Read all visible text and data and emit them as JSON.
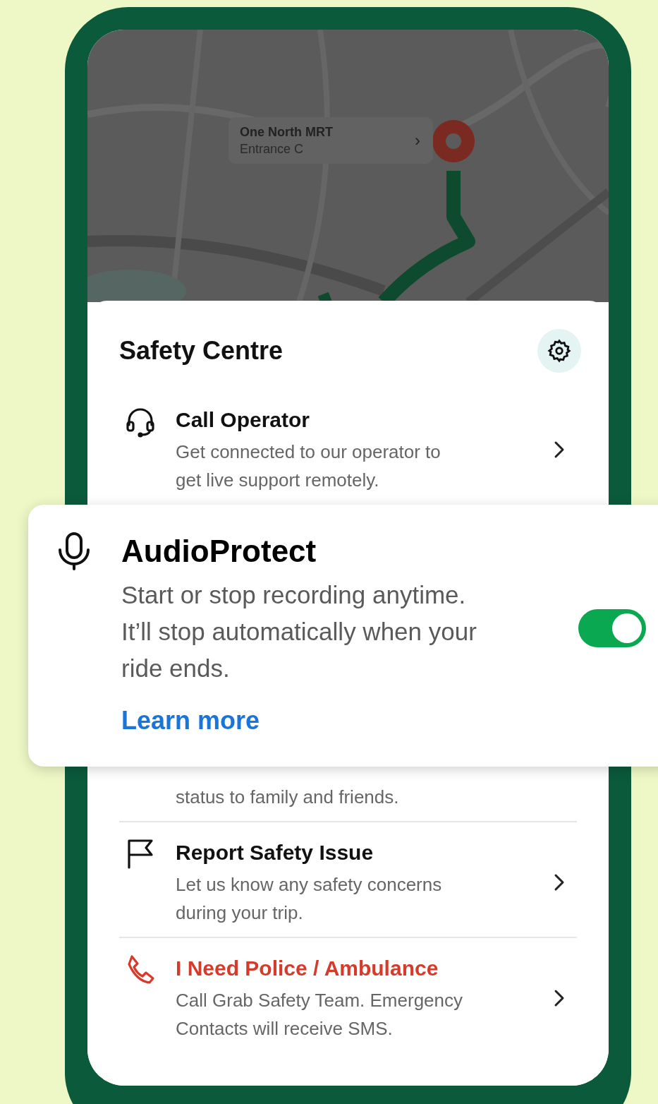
{
  "map": {
    "place_card": {
      "title": "One North MRT",
      "subtitle": "Entrance C",
      "chevron": "›"
    }
  },
  "sheet": {
    "title": "Safety Centre",
    "items": [
      {
        "kind": "normal",
        "title": "Call Operator",
        "description_lines": [
          "Get connected to our operator to",
          "get live support remotely."
        ]
      },
      {
        "kind": "normal",
        "description_lines": [
          "status to family and friends."
        ]
      },
      {
        "kind": "normal",
        "title": "Report Safety Issue",
        "description_lines": [
          "Let us know any safety concerns",
          "during your trip."
        ]
      },
      {
        "kind": "emergency",
        "title": "I Need Police / Ambulance",
        "description_lines": [
          "Call Grab Safety Team. Emergency",
          "Contacts will receive SMS."
        ]
      }
    ]
  },
  "audio_protect": {
    "title": "AudioProtect",
    "description_lines": [
      "Start or stop recording anytime.",
      "It’ll stop automatically when your",
      "ride ends."
    ],
    "toggle": {
      "on": true
    },
    "link": "Learn more"
  }
}
